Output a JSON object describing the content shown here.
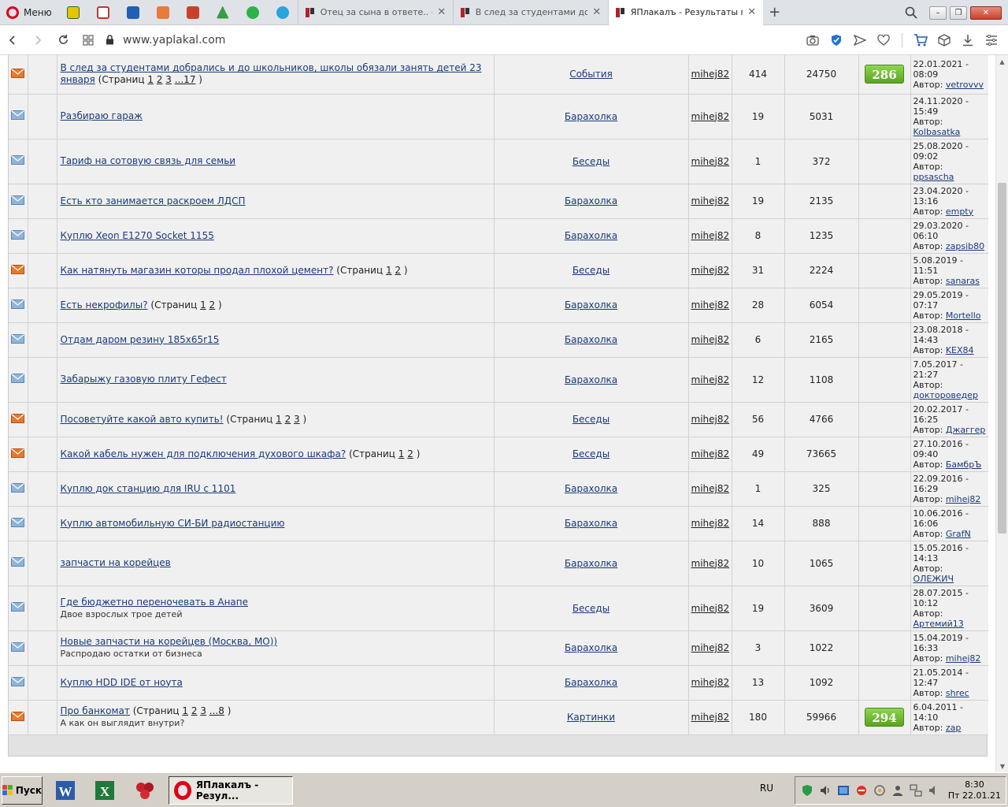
{
  "browser": {
    "menu_label": "Меню",
    "tabs": [
      {
        "title": "Отец за сына в ответе.. - ЯП",
        "active": false
      },
      {
        "title": "В след за студентами добра",
        "active": false
      },
      {
        "title": "ЯПлакалъ - Результаты поис",
        "active": true
      }
    ],
    "new_tab_symbol": "+",
    "url": "www.yaplakal.com"
  },
  "topics": [
    {
      "title": "В след за студентами добрались и до школьников, школы обязали занять детей 23 января",
      "pages_prefix": "(Страниц",
      "pages": [
        "1",
        "2",
        "3",
        "...17"
      ],
      "pages_suffix": ")",
      "desc": "",
      "forum": "События",
      "author": "mihej82",
      "replies": "414",
      "views": "24750",
      "rating": "286",
      "last_date": "22.01.2021 - 08:09",
      "last_label": "Автор:",
      "last_author": "vetrovvv",
      "icon": "hot"
    },
    {
      "title": "Разбираю гараж",
      "pages_prefix": "",
      "pages": [],
      "pages_suffix": "",
      "desc": "",
      "forum": "Барахолка",
      "author": "mihej82",
      "replies": "19",
      "views": "5031",
      "rating": "",
      "last_date": "24.11.2020 - 15:49",
      "last_label": "Автор:",
      "last_author": "Kolbasatka",
      "icon": "normal"
    },
    {
      "title": "Тариф на сотовую связь для семьи",
      "pages_prefix": "",
      "pages": [],
      "pages_suffix": "",
      "desc": "",
      "forum": "Беседы",
      "author": "mihej82",
      "replies": "1",
      "views": "372",
      "rating": "",
      "last_date": "25.08.2020 - 09:02",
      "last_label": "Автор:",
      "last_author": "ppsascha",
      "icon": "normal"
    },
    {
      "title": "Есть кто занимается раскроем ЛДСП",
      "pages_prefix": "",
      "pages": [],
      "pages_suffix": "",
      "desc": "",
      "forum": "Барахолка",
      "author": "mihej82",
      "replies": "19",
      "views": "2135",
      "rating": "",
      "last_date": "23.04.2020 - 13:16",
      "last_label": "Автор:",
      "last_author": "empty",
      "icon": "normal"
    },
    {
      "title": "Куплю Xeon E1270 Socket 1155",
      "pages_prefix": "",
      "pages": [],
      "pages_suffix": "",
      "desc": "",
      "forum": "Барахолка",
      "author": "mihej82",
      "replies": "8",
      "views": "1235",
      "rating": "",
      "last_date": "29.03.2020 - 06:10",
      "last_label": "Автор:",
      "last_author": "zapsib80",
      "icon": "normal"
    },
    {
      "title": "Как натянуть магазин которы продал плохой цемент?",
      "pages_prefix": "(Страниц",
      "pages": [
        "1",
        "2"
      ],
      "pages_suffix": ")",
      "desc": "",
      "forum": "Беседы",
      "author": "mihej82",
      "replies": "31",
      "views": "2224",
      "rating": "",
      "last_date": "5.08.2019 - 11:51",
      "last_label": "Автор:",
      "last_author": "sanaras",
      "icon": "hot"
    },
    {
      "title": "Есть некрофилы?",
      "pages_prefix": "(Страниц",
      "pages": [
        "1",
        "2"
      ],
      "pages_suffix": ")",
      "desc": "",
      "forum": "Барахолка",
      "author": "mihej82",
      "replies": "28",
      "views": "6054",
      "rating": "",
      "last_date": "29.05.2019 - 07:17",
      "last_label": "Автор:",
      "last_author": "Mortello",
      "icon": "normal"
    },
    {
      "title": "Отдам даром резину 185х65r15",
      "pages_prefix": "",
      "pages": [],
      "pages_suffix": "",
      "desc": "",
      "forum": "Барахолка",
      "author": "mihej82",
      "replies": "6",
      "views": "2165",
      "rating": "",
      "last_date": "23.08.2018 - 14:43",
      "last_label": "Автор:",
      "last_author": "KEX84",
      "icon": "normal"
    },
    {
      "title": "Забарыжу газовую плиту Гефест",
      "pages_prefix": "",
      "pages": [],
      "pages_suffix": "",
      "desc": "",
      "forum": "Барахолка",
      "author": "mihej82",
      "replies": "12",
      "views": "1108",
      "rating": "",
      "last_date": "7.05.2017 - 21:27",
      "last_label": "Автор:",
      "last_author": "доктороведер",
      "icon": "normal"
    },
    {
      "title": "Посоветуйте какой авто купить!",
      "pages_prefix": "(Страниц",
      "pages": [
        "1",
        "2",
        "3"
      ],
      "pages_suffix": ")",
      "desc": "",
      "forum": "Беседы",
      "author": "mihej82",
      "replies": "56",
      "views": "4766",
      "rating": "",
      "last_date": "20.02.2017 - 16:25",
      "last_label": "Автор:",
      "last_author": "Джаггер",
      "icon": "hot"
    },
    {
      "title": "Какой кабель нужен для подключения духового шкафа?",
      "pages_prefix": "(Страниц",
      "pages": [
        "1",
        "2"
      ],
      "pages_suffix": ")",
      "desc": "",
      "forum": "Беседы",
      "author": "mihej82",
      "replies": "49",
      "views": "73665",
      "rating": "",
      "last_date": "27.10.2016 - 09:40",
      "last_label": "Автор:",
      "last_author": "БамбрЪ",
      "icon": "hot"
    },
    {
      "title": "Куплю док станцию для IRU с 1101",
      "pages_prefix": "",
      "pages": [],
      "pages_suffix": "",
      "desc": "",
      "forum": "Барахолка",
      "author": "mihej82",
      "replies": "1",
      "views": "325",
      "rating": "",
      "last_date": "22.09.2016 - 16:29",
      "last_label": "Автор:",
      "last_author": "mihej82",
      "icon": "normal"
    },
    {
      "title": "Куплю автомобильную СИ-БИ радиостанцию",
      "pages_prefix": "",
      "pages": [],
      "pages_suffix": "",
      "desc": "",
      "forum": "Барахолка",
      "author": "mihej82",
      "replies": "14",
      "views": "888",
      "rating": "",
      "last_date": "10.06.2016 - 16:06",
      "last_label": "Автор:",
      "last_author": "GrafN",
      "icon": "normal"
    },
    {
      "title": "запчасти на корейцев",
      "pages_prefix": "",
      "pages": [],
      "pages_suffix": "",
      "desc": "",
      "forum": "Барахолка",
      "author": "mihej82",
      "replies": "10",
      "views": "1065",
      "rating": "",
      "last_date": "15.05.2016 - 14:13",
      "last_label": "Автор:",
      "last_author": "ОЛЕЖИЧ",
      "icon": "normal"
    },
    {
      "title": "Где бюджетно переночевать в Анапе",
      "pages_prefix": "",
      "pages": [],
      "pages_suffix": "",
      "desc": "Двое взрослых трое детей",
      "forum": "Беседы",
      "author": "mihej82",
      "replies": "19",
      "views": "3609",
      "rating": "",
      "last_date": "28.07.2015 - 10:12",
      "last_label": "Автор:",
      "last_author": "Артемий13",
      "icon": "normal"
    },
    {
      "title": "Новые запчасти на корейцев (Москва, МО))",
      "pages_prefix": "",
      "pages": [],
      "pages_suffix": "",
      "desc": "Распродаю остатки от бизнеса",
      "forum": "Барахолка",
      "author": "mihej82",
      "replies": "3",
      "views": "1022",
      "rating": "",
      "last_date": "15.04.2019 - 16:33",
      "last_label": "Автор:",
      "last_author": "mihej82",
      "icon": "normal"
    },
    {
      "title": "Куплю HDD IDE от ноута",
      "pages_prefix": "",
      "pages": [],
      "pages_suffix": "",
      "desc": "",
      "forum": "Барахолка",
      "author": "mihej82",
      "replies": "13",
      "views": "1092",
      "rating": "",
      "last_date": "21.05.2014 - 12:47",
      "last_label": "Автор:",
      "last_author": "shrec",
      "icon": "normal"
    },
    {
      "title": "Про банкомат",
      "pages_prefix": "(Страниц",
      "pages": [
        "1",
        "2",
        "3",
        "...8"
      ],
      "pages_suffix": ")",
      "desc": "А как он выглядит внутри?",
      "forum": "Картинки",
      "author": "mihej82",
      "replies": "180",
      "views": "59966",
      "rating": "294",
      "last_date": "6.04.2011 - 14:10",
      "last_label": "Автор:",
      "last_author": "zap",
      "icon": "hot"
    }
  ],
  "taskbar": {
    "start_label": "Пуск",
    "active_task": "ЯПлакалъ - Резул...",
    "lang": "RU",
    "time": "8:30",
    "date": "Пт 22.01.21"
  },
  "colors": {
    "link": "#1a3a7a",
    "rating_green": "#6cbf2e",
    "envelope_hot": "#e8792b",
    "envelope_normal": "#8fb4d9"
  }
}
